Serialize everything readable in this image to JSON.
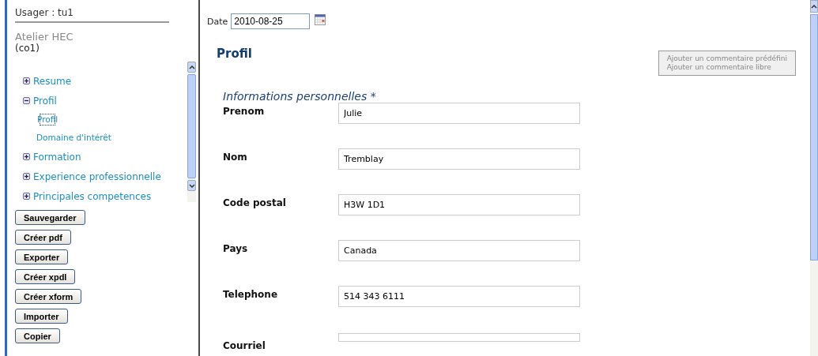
{
  "sidebar": {
    "user": "Usager : tu1",
    "organization": "Atelier HEC",
    "organization_code": "(co1)",
    "tree": [
      {
        "label": "Resume",
        "expanded": false
      },
      {
        "label": "Profil",
        "expanded": true,
        "children": [
          {
            "label": "Profil",
            "selected": true
          },
          {
            "label": "Domaine d'intérêt",
            "selected": false
          }
        ]
      },
      {
        "label": "Formation",
        "expanded": false
      },
      {
        "label": "Experience professionnelle",
        "expanded": false
      },
      {
        "label": "Principales competences",
        "expanded": false
      }
    ],
    "buttons": [
      "Sauvegarder",
      "Créer pdf",
      "Exporter",
      "Créer xpdl",
      "Créer xform",
      "Importer",
      "Copier"
    ]
  },
  "date": {
    "label": "Date",
    "value": "2010-08-25"
  },
  "title": "Profil",
  "comment_menu": [
    "Ajouter un commentaire prédéfini",
    "Ajouter un commentaire libre"
  ],
  "section": {
    "title": "Informations personnelles",
    "required_mark": "*",
    "fields": [
      {
        "label": "Prenom",
        "value": "Julie"
      },
      {
        "label": "Nom",
        "value": "Tremblay"
      },
      {
        "label": "Code postal",
        "value": "H3W 1D1"
      },
      {
        "label": "Pays",
        "value": "Canada"
      },
      {
        "label": "Telephone",
        "value": "514 343 6111"
      },
      {
        "label": "Courriel"
      }
    ]
  }
}
